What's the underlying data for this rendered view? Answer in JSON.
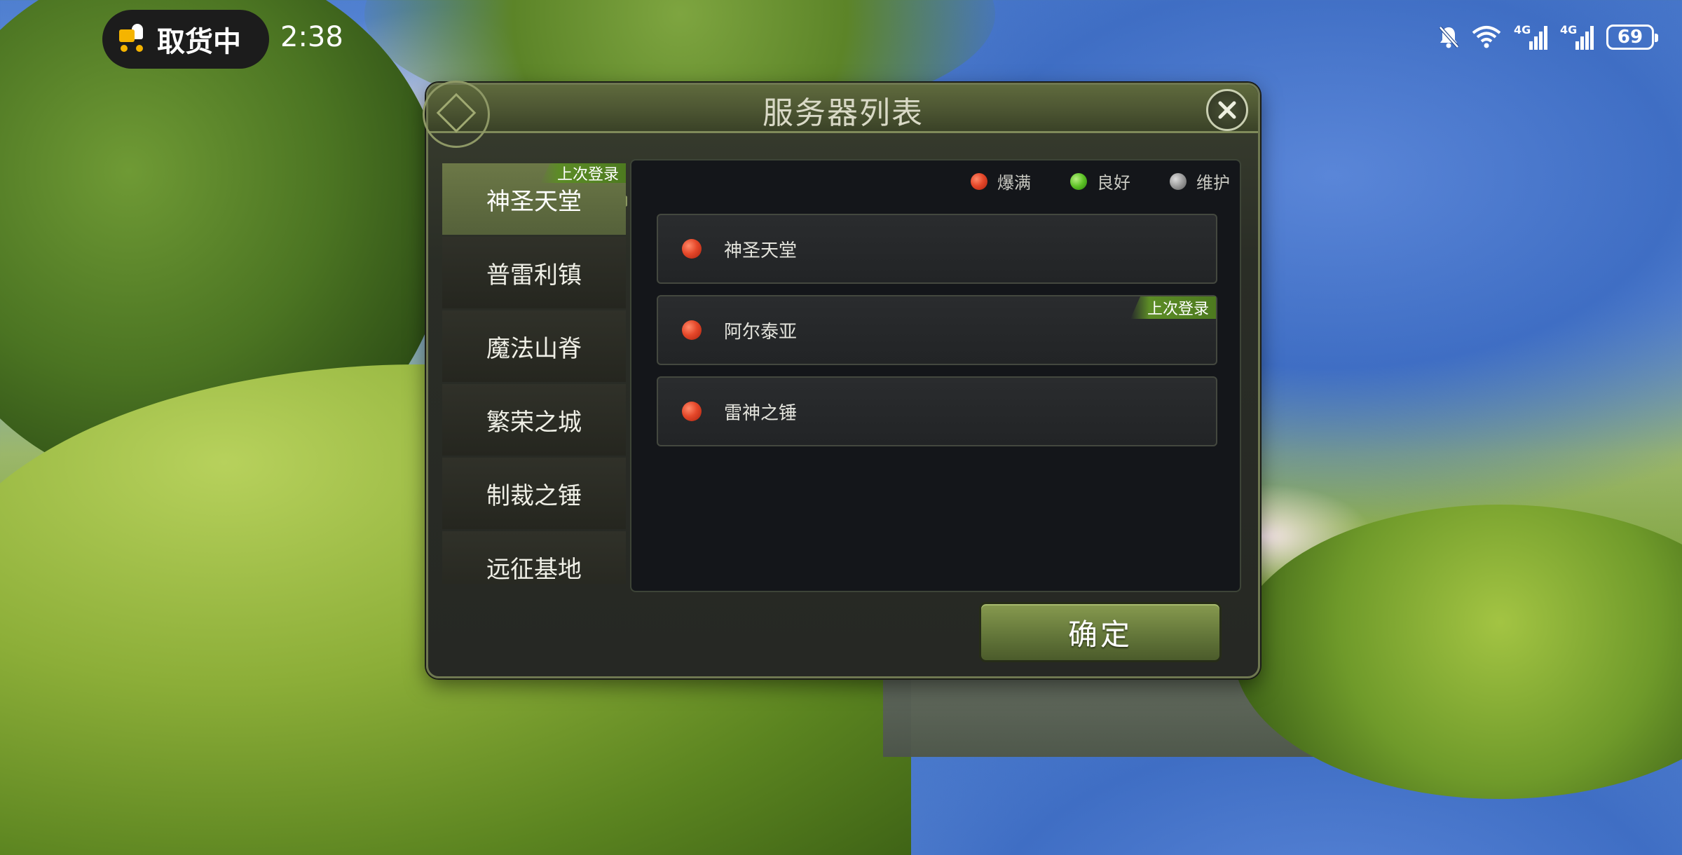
{
  "status_bar": {
    "pill_text": "取货中",
    "clock": "2:38",
    "signal1_tag": "4G",
    "signal2_tag": "4G",
    "battery": "69"
  },
  "dialog": {
    "title": "服务器列表",
    "confirm_label": "确定",
    "last_login_tag": "上次登录"
  },
  "sidebar": {
    "items": [
      {
        "label": "神圣天堂",
        "active": true,
        "tag": "上次登录"
      },
      {
        "label": "普雷利镇"
      },
      {
        "label": "魔法山脊"
      },
      {
        "label": "繁荣之城"
      },
      {
        "label": "制裁之锤"
      },
      {
        "label": "远征基地"
      }
    ]
  },
  "legend": {
    "full": "爆满",
    "good": "良好",
    "maintenance": "维护",
    "colors": {
      "full": "#e5482a",
      "good": "#5cc125",
      "maintenance": "#9a9a9a"
    }
  },
  "servers": [
    {
      "name": "神圣天堂",
      "status": "full"
    },
    {
      "name": "阿尔泰亚",
      "status": "full",
      "tag": "上次登录"
    },
    {
      "name": "雷神之锤",
      "status": "full"
    }
  ]
}
